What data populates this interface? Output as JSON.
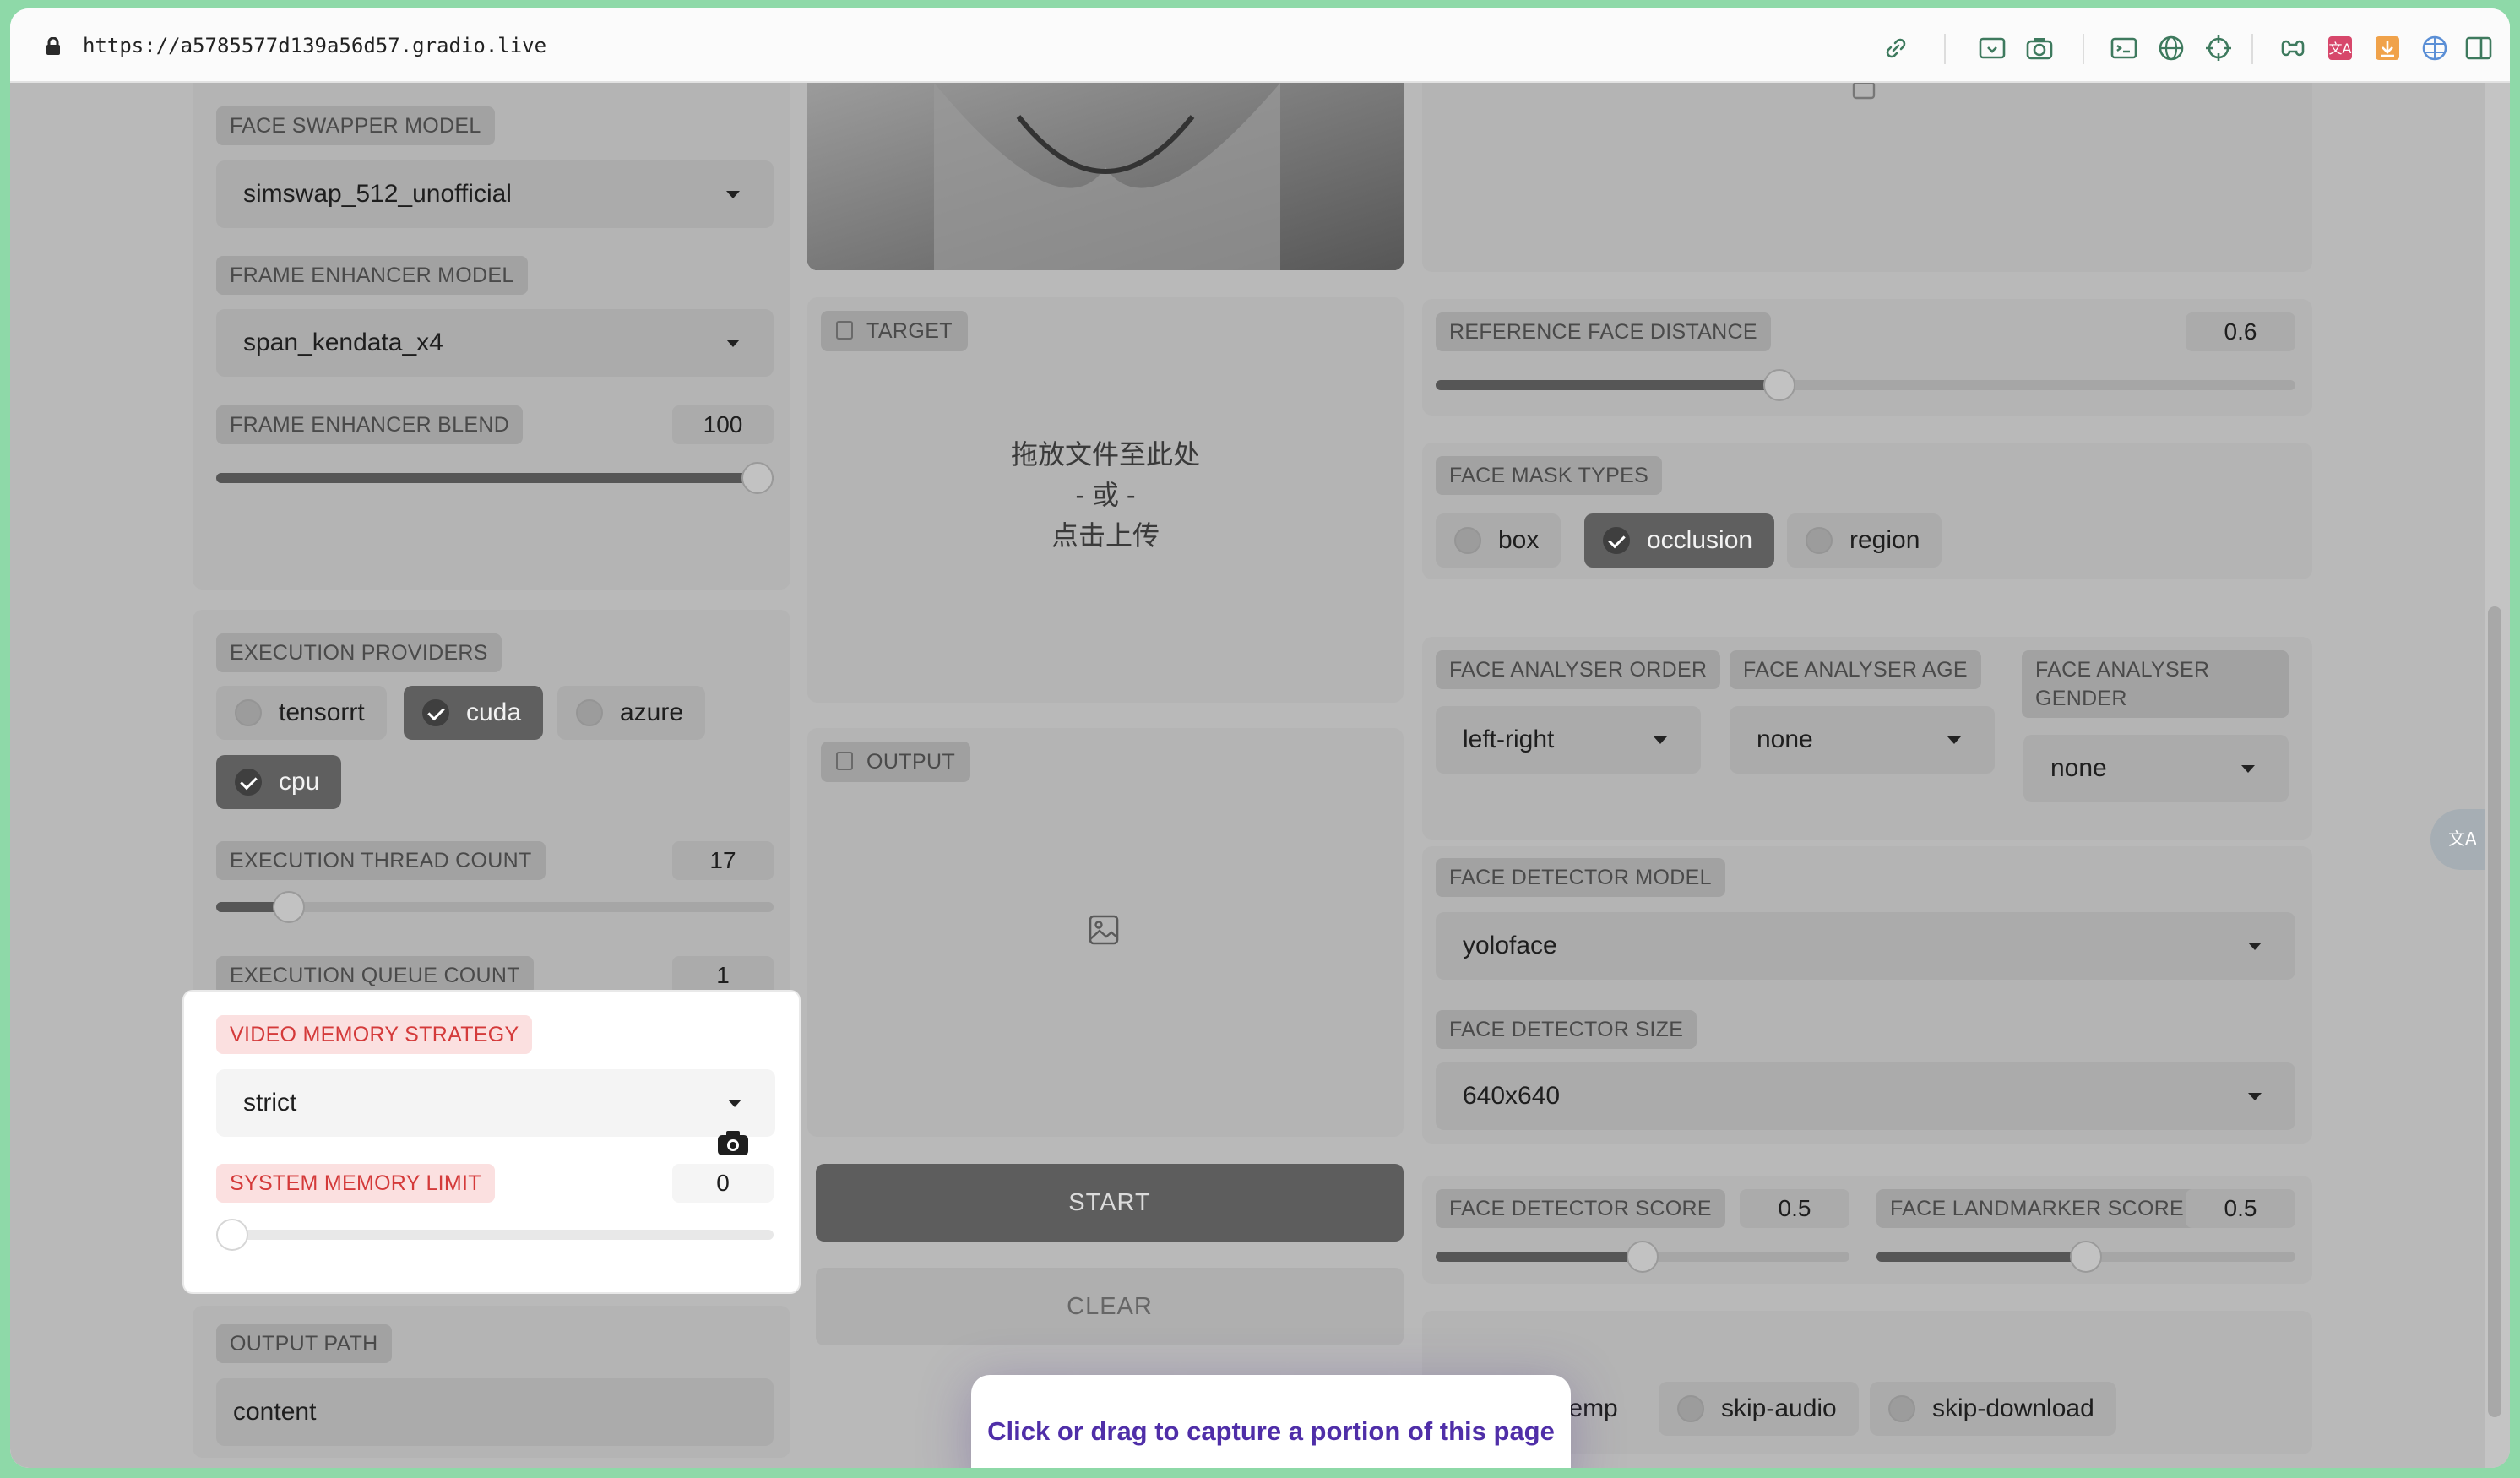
{
  "browser": {
    "url": "https://a5785577d139a56d57.gradio.live"
  },
  "left": {
    "face_swapper_model": {
      "label": "FACE SWAPPER MODEL",
      "value": "simswap_512_unofficial"
    },
    "frame_enhancer_model": {
      "label": "FRAME ENHANCER MODEL",
      "value": "span_kendata_x4"
    },
    "frame_enhancer_blend": {
      "label": "FRAME ENHANCER BLEND",
      "value": "100",
      "fraction": 1.0
    },
    "execution_providers": {
      "label": "EXECUTION PROVIDERS",
      "options": [
        {
          "label": "tensorrt",
          "checked": false
        },
        {
          "label": "cuda",
          "checked": true
        },
        {
          "label": "azure",
          "checked": false
        },
        {
          "label": "cpu",
          "checked": true
        }
      ]
    },
    "execution_thread_count": {
      "label": "EXECUTION THREAD COUNT",
      "value": "17",
      "fraction": 0.13
    },
    "execution_queue_count": {
      "label": "EXECUTION QUEUE COUNT",
      "value": "1",
      "fraction": 0.0
    },
    "video_memory_strategy": {
      "label": "VIDEO MEMORY STRATEGY",
      "value": "strict"
    },
    "system_memory_limit": {
      "label": "SYSTEM MEMORY LIMIT",
      "value": "0",
      "fraction": 0.0
    },
    "output_path": {
      "label": "OUTPUT PATH",
      "value": "content"
    }
  },
  "middle": {
    "target": {
      "label": "TARGET",
      "drop_line1": "拖放文件至此处",
      "drop_line2": "- 或 -",
      "drop_line3": "点击上传"
    },
    "output": {
      "label": "OUTPUT"
    },
    "start_label": "START",
    "clear_label": "CLEAR"
  },
  "right": {
    "reference_face_distance": {
      "label": "REFERENCE FACE DISTANCE",
      "value": "0.6",
      "fraction": 0.4
    },
    "face_mask_types": {
      "label": "FACE MASK TYPES",
      "options": [
        {
          "label": "box",
          "checked": false
        },
        {
          "label": "occlusion",
          "checked": true
        },
        {
          "label": "region",
          "checked": false
        }
      ]
    },
    "face_analyser_order": {
      "label": "FACE ANALYSER ORDER",
      "value": "left-right"
    },
    "face_analyser_age": {
      "label": "FACE ANALYSER AGE",
      "value": "none"
    },
    "face_analyser_gender": {
      "label": "FACE ANALYSER GENDER",
      "value": "none"
    },
    "face_detector_model": {
      "label": "FACE DETECTOR MODEL",
      "value": "yoloface"
    },
    "face_detector_size": {
      "label": "FACE DETECTOR SIZE",
      "value": "640x640"
    },
    "face_detector_score": {
      "label": "FACE DETECTOR SCORE",
      "value": "0.5",
      "fraction": 0.5
    },
    "face_landmarker_score": {
      "label": "FACE LANDMARKER SCORE",
      "value": "0.5",
      "fraction": 0.5
    },
    "options": [
      {
        "label": "keep-temp",
        "checked": false
      },
      {
        "label": "skip-audio",
        "checked": false
      },
      {
        "label": "skip-download",
        "checked": false
      }
    ]
  },
  "overlay": {
    "capture_hint": "Click or drag to capture a portion of this page"
  }
}
